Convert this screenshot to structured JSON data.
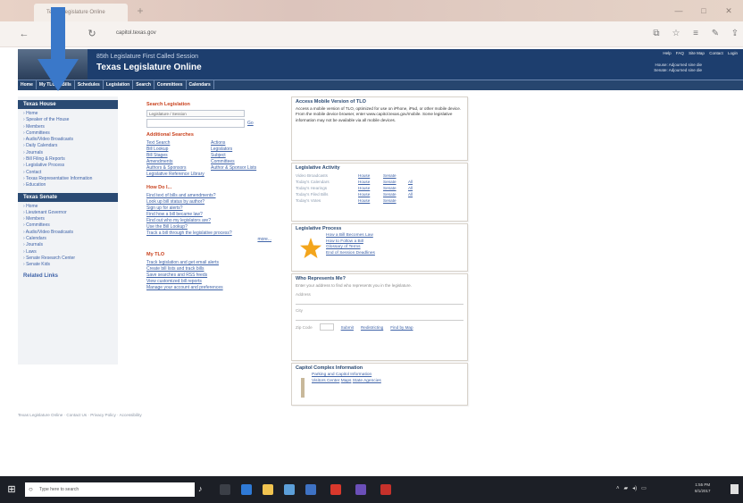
{
  "browser": {
    "tab_title": "Texas Legislature Online",
    "new_tab": "+",
    "url": "capitol.texas.gov",
    "win_min": "—",
    "win_max": "□",
    "win_close": "✕",
    "back": "←",
    "forward": "→",
    "refresh": "↻"
  },
  "header": {
    "subtitle": "85th Legislature First Called Session",
    "title": "Texas Legislature Online",
    "top_links": [
      "Help",
      "FAQ",
      "Site Map",
      "Contact",
      "Login"
    ],
    "session_lines": [
      "House: Adjourned sine die",
      "Senate: Adjourned sine die"
    ]
  },
  "topnav": [
    "Home",
    "My TLO",
    "Bills",
    "Schedules",
    "Legislation",
    "Search",
    "Committees",
    "Calendars"
  ],
  "sidebar": {
    "house_heading": "Texas House",
    "house_items": [
      "Home",
      "Speaker of the House",
      "Members",
      "Committees",
      "Audio/Video Broadcasts",
      "Daily Calendars",
      "Journals",
      "Bill Filing & Reports",
      "Legislative Process",
      "Contact",
      "Texas Representative Information",
      "Education"
    ],
    "senate_heading": "Texas Senate",
    "senate_items": [
      "Home",
      "Lieutenant Governor",
      "Members",
      "Committees",
      "Audio/Video Broadcasts",
      "Calendars",
      "Journals",
      "Laws",
      "Senate Research Center",
      "Senate Kids"
    ],
    "related": "Related Links"
  },
  "middle": {
    "search_heading": "Search Legislation",
    "search_placeholder": "",
    "search_select": "Legislature / Session",
    "search_go": "Go",
    "addl_heading": "Additional Searches",
    "addl": [
      [
        "Text Search",
        "Actions"
      ],
      [
        "Bill Lookup",
        "Legislators"
      ],
      [
        "Bill Stages",
        "Subject"
      ],
      [
        "Amendments",
        "Committees"
      ],
      [
        "Authors & Sponsors",
        "Author & Sponsor Lists"
      ],
      [
        "Legislative Reference Library",
        ""
      ]
    ],
    "howdoi_heading": "How Do I...",
    "howdoi": [
      "Find text of bills and amendments?",
      "Look up bill status by author?",
      "Sign up for alerts?",
      "Find how a bill became law?",
      "Find out who my legislators are?",
      "Use the Bill Lookup?",
      "Track a bill through the legislative process?"
    ],
    "more": "more...",
    "mytlo_heading": "My TLO",
    "mytlo": [
      "Track legislation and get email alerts",
      "Create bill lists and track bills",
      "Save searches and RSS feeds",
      "View customized bill reports",
      "Manage your account and preferences"
    ]
  },
  "mobile": {
    "heading": "Access Mobile Version of TLO",
    "text": "Access a mobile version of TLO, optimized for use on iPhone, iPad, or other mobile device. From the mobile device browser, enter www.capitol.texas.gov/mobile. Some legislative information may not be available via all mobile devices."
  },
  "activity": {
    "heading": "Legislative Activity",
    "rows": [
      {
        "label": "Video Broadcasts",
        "house": "House",
        "senate": "Senate",
        "all": ""
      },
      {
        "label": "Today's Calendars",
        "house": "House",
        "senate": "Senate",
        "all": "All"
      },
      {
        "label": "Today's Hearings",
        "house": "House",
        "senate": "Senate",
        "all": "All"
      },
      {
        "label": "Today's Filed Bills",
        "house": "House",
        "senate": "Senate",
        "all": "All"
      },
      {
        "label": "Today's Votes",
        "house": "House",
        "senate": "Senate",
        "all": ""
      }
    ]
  },
  "process": {
    "heading": "Legislative Process",
    "items": [
      "How a Bill Becomes Law",
      "How to Follow a Bill",
      "Glossary of Terms",
      "End of Session Deadlines"
    ]
  },
  "represents": {
    "heading": "Who Represents Me?",
    "text": "Enter your address to find who represents you in the legislature.",
    "address_label": "Address",
    "city_label": "City",
    "zip_label": "Zip Code",
    "submit": "Submit",
    "link1": "Redistricting",
    "link2": "Find by Map"
  },
  "capitol": {
    "heading": "Capitol Complex Information",
    "items": [
      "Parking and Capitol Information",
      "Visitors Center",
      "Maps",
      "State Agencies"
    ]
  },
  "footer": "Texas Legislature Online  ·  Contact Us  ·  Privacy Policy  ·  Accessibility",
  "taskbar": {
    "start": "⊞",
    "search_placeholder": "Type here to search",
    "clock_time": "1:55 PM",
    "clock_date": "8/1/2017"
  }
}
